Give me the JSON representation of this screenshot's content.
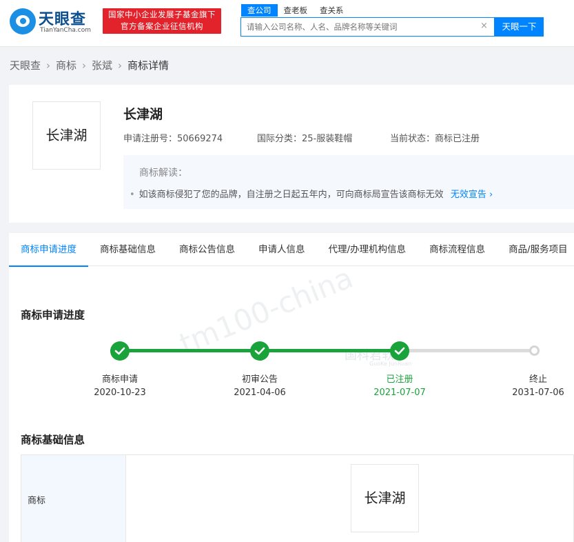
{
  "header": {
    "logo_name": "天眼查",
    "logo_sub": "TianYanCha.com",
    "gov_badge_line1": "国家中小企业发展子基金旗下",
    "gov_badge_line2": "官方备案企业征信机构",
    "search_tabs": [
      {
        "label": "查公司"
      },
      {
        "label": "查老板"
      },
      {
        "label": "查关系"
      }
    ],
    "search_placeholder": "请输入公司名称、人名、品牌名称等关键词",
    "clear_icon": "×",
    "search_button": "天眼一下"
  },
  "breadcrumb": [
    "天眼查",
    "商标",
    "张斌",
    "商标详情"
  ],
  "trademark": {
    "name": "长津湖",
    "reg_no": "申请注册号：50669274",
    "intl_class": "国际分类：25-服装鞋帽",
    "status": "当前状态：商标已注册",
    "reading_title": "商标解读：",
    "reading_text": "如该商标侵犯了您的品牌，自注册之日起五年内，可向商标局宣告该商标无效",
    "reading_link": "无效宣告"
  },
  "tabs": [
    {
      "label": "商标申请进度"
    },
    {
      "label": "商标基础信息"
    },
    {
      "label": "商标公告信息"
    },
    {
      "label": "申请人信息"
    },
    {
      "label": "代理/办理机构信息"
    },
    {
      "label": "商标流程信息"
    },
    {
      "label": "商品/服务项目"
    }
  ],
  "progress": {
    "title": "商标申请进度",
    "steps": [
      {
        "label": "商标申请",
        "date": "2020-10-23",
        "state": "done"
      },
      {
        "label": "初审公告",
        "date": "2021-04-06",
        "state": "done"
      },
      {
        "label": "已注册",
        "date": "2021-07-07",
        "state": "current"
      },
      {
        "label": "终止",
        "date": "2031-07-06",
        "state": "pending"
      }
    ],
    "colors": {
      "done": "#1aa33b",
      "pending": "#d5d5d5"
    }
  },
  "basic_info": {
    "title": "商标基础信息",
    "row_label": "商标",
    "image_text": "长津湖"
  },
  "watermarks": {
    "diagonal": "tm100-china",
    "brand": "国科君软",
    "brand_sub": "GuoKe JunRuan"
  },
  "colors": {
    "accent": "#0084ff",
    "badge_red": "#e2232c",
    "success": "#1aa33b"
  }
}
